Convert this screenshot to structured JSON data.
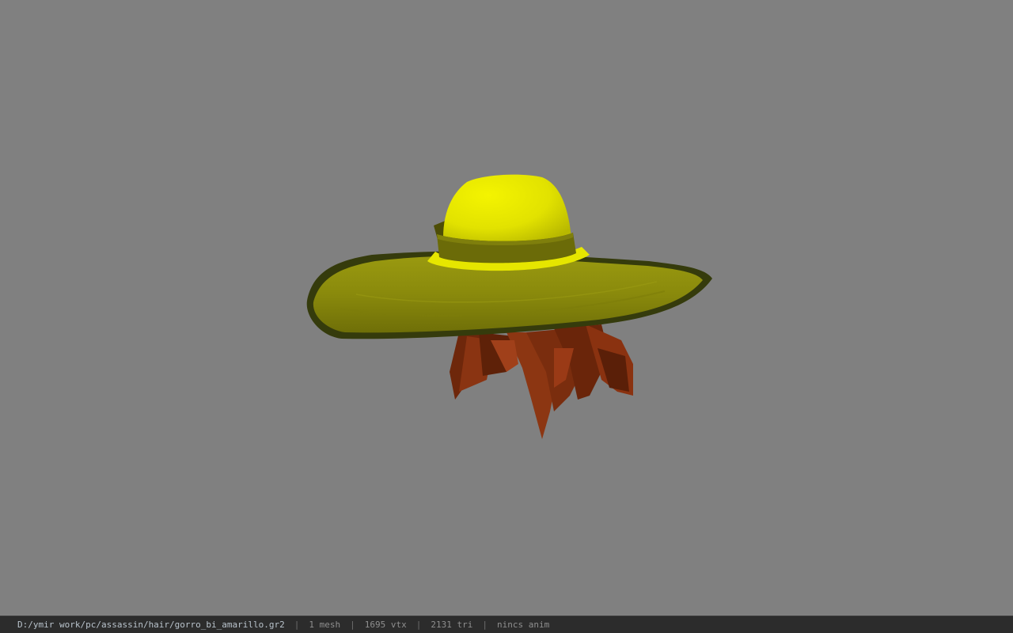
{
  "viewport": {
    "background_color": "#808080",
    "model": "gorro_bi_amarillo",
    "colors": {
      "hat_crown": "#e6e600",
      "hat_band": "#6b6b08",
      "hat_brim": "#8a8a0e",
      "brim_edge": "#333a0c",
      "hair": "#7a2e0e"
    }
  },
  "status_bar": {
    "file_path": "D:/ymir work/pc/assassin/hair/gorro_bi_amarillo.gr2",
    "separator": "|",
    "mesh": "1 mesh",
    "vertices": "1695 vtx",
    "triangles": "2131 tri",
    "animation": "nincs anim"
  }
}
